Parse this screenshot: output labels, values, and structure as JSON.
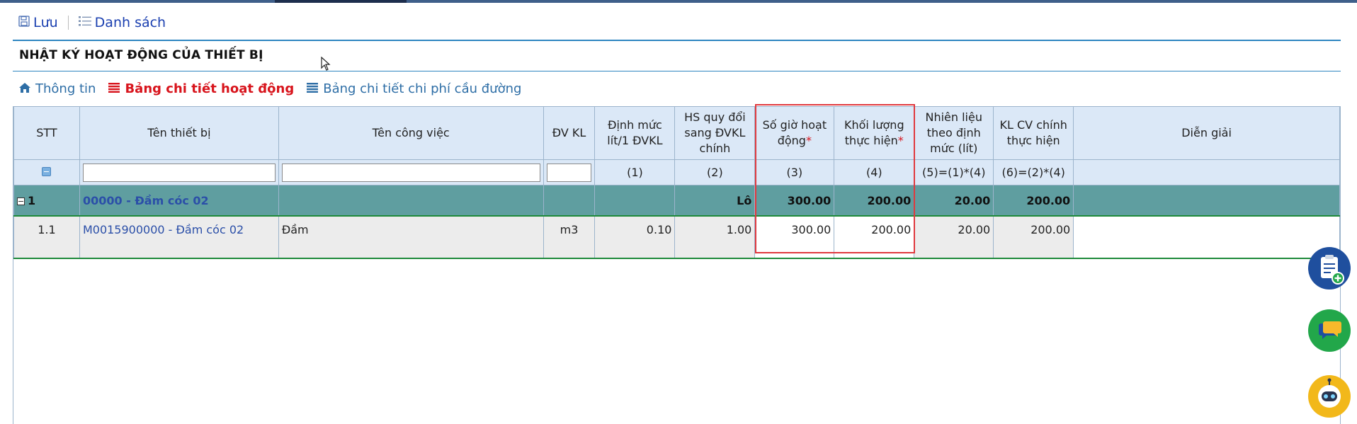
{
  "toolbar": {
    "save_label": "Lưu",
    "list_label": "Danh sách"
  },
  "page": {
    "title": "NHẬT KÝ HOẠT ĐỘNG CỦA THIẾT BỊ"
  },
  "tabs": [
    {
      "label": "Thông tin",
      "icon": "home-icon",
      "active": false
    },
    {
      "label": "Bảng chi tiết hoạt động",
      "icon": "list-icon",
      "active": true
    },
    {
      "label": "Bảng chi tiết chi phí cầu đường",
      "icon": "list-icon",
      "active": false
    }
  ],
  "table": {
    "headers": {
      "stt": "STT",
      "device": "Tên thiết bị",
      "job": "Tên công việc",
      "unit": "ĐV KL",
      "norm": "Định mức lít/1 ĐVKL",
      "coef": "HS quy đổi sang ĐVKL chính",
      "hours": "Số giờ hoạt động",
      "volume": "Khối lượng thực hiện",
      "fuel": "Nhiên liệu theo định mức (lít)",
      "main_volume": "KL CV chính thực hiện",
      "note": "Diễn giải",
      "required_mark": "*"
    },
    "formula_row": {
      "norm": "(1)",
      "coef": "(2)",
      "hours": "(3)",
      "volume": "(4)",
      "fuel": "(5)=(1)*(4)",
      "main_volume": "(6)=(2)*(4)"
    },
    "group": {
      "stt": "1",
      "device": "00000 - Đầm cóc 02",
      "coef": "Lô",
      "hours": "300.00",
      "volume": "200.00",
      "fuel": "20.00",
      "main_volume": "200.00"
    },
    "rows": [
      {
        "stt": "1.1",
        "device": "M0015900000 - Đầm cóc 02",
        "job": "Đầm",
        "unit": "m3",
        "norm": "0.10",
        "coef": "1.00",
        "hours": "300.00",
        "volume": "200.00",
        "fuel": "20.00",
        "main_volume": "200.00",
        "note": ""
      }
    ]
  },
  "colors": {
    "accent": "#2e86c1",
    "group_row": "#5f9ea0",
    "active_tab": "#d8141c",
    "highlight": "#e0393e"
  }
}
